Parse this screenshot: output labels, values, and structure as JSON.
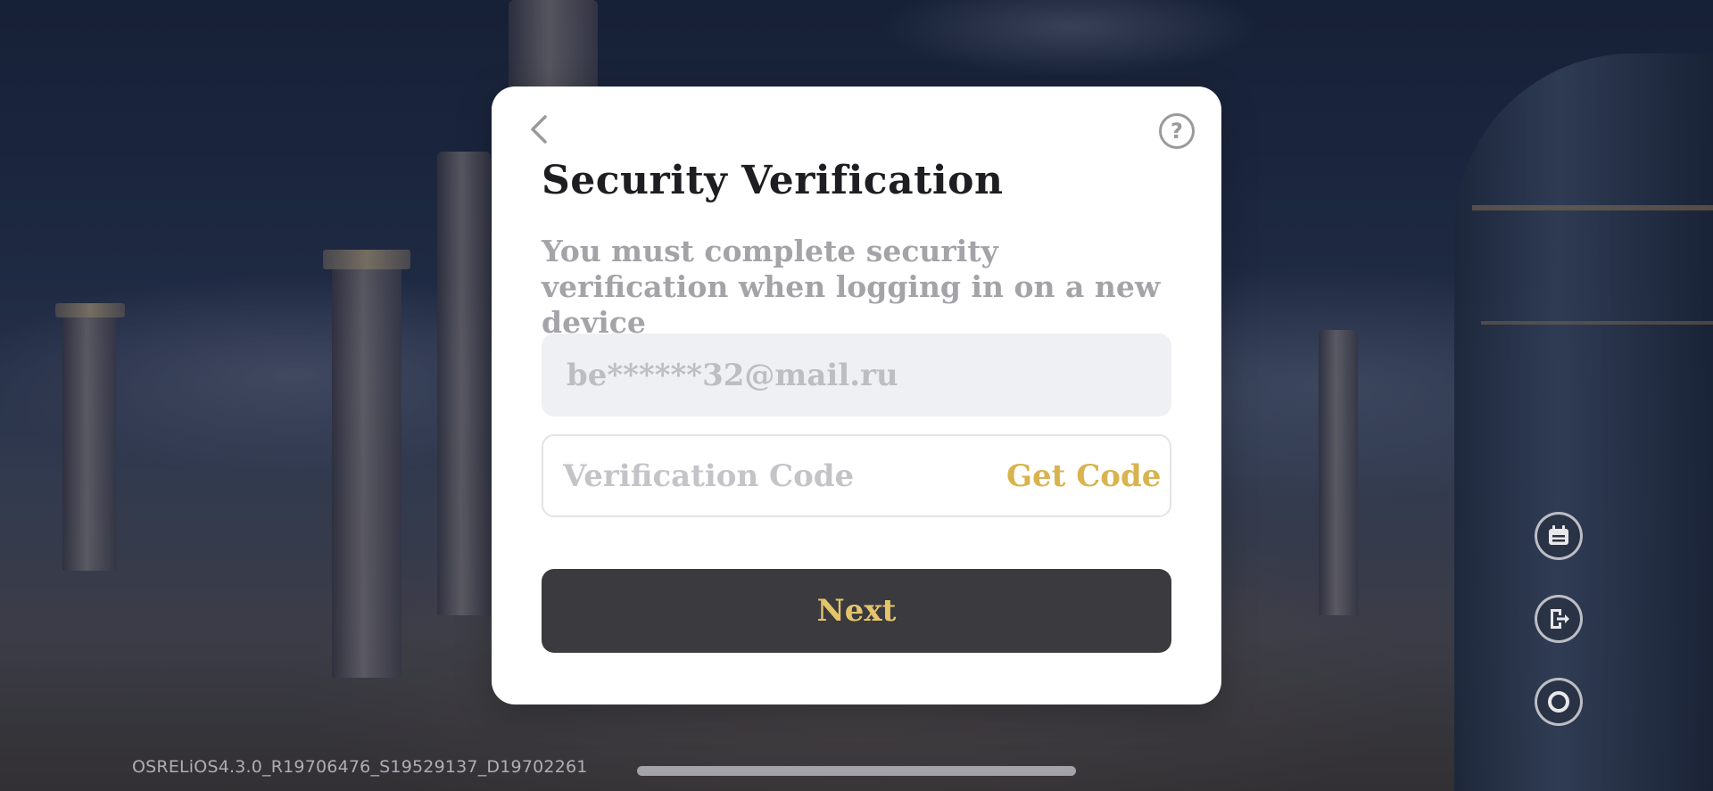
{
  "modal": {
    "title": "Security Verification",
    "subtitle": "You must complete security verification when logging in on a new device",
    "back_icon": "chevron-left-icon",
    "help_icon": "question-circle-icon",
    "help_glyph": "?",
    "email_value": "be******32@mail.ru",
    "code_placeholder": "Verification Code",
    "get_code_label": "Get Code",
    "next_label": "Next",
    "accent_color": "#d8b34f",
    "button_color": "#3a3a3f"
  },
  "side_buttons": [
    {
      "icon": "notice-board-icon"
    },
    {
      "icon": "logout-icon"
    },
    {
      "icon": "ring-icon"
    }
  ],
  "footer": {
    "build_info": "OSRELiOS4.3.0_R19706476_S19529137_D19702261"
  }
}
